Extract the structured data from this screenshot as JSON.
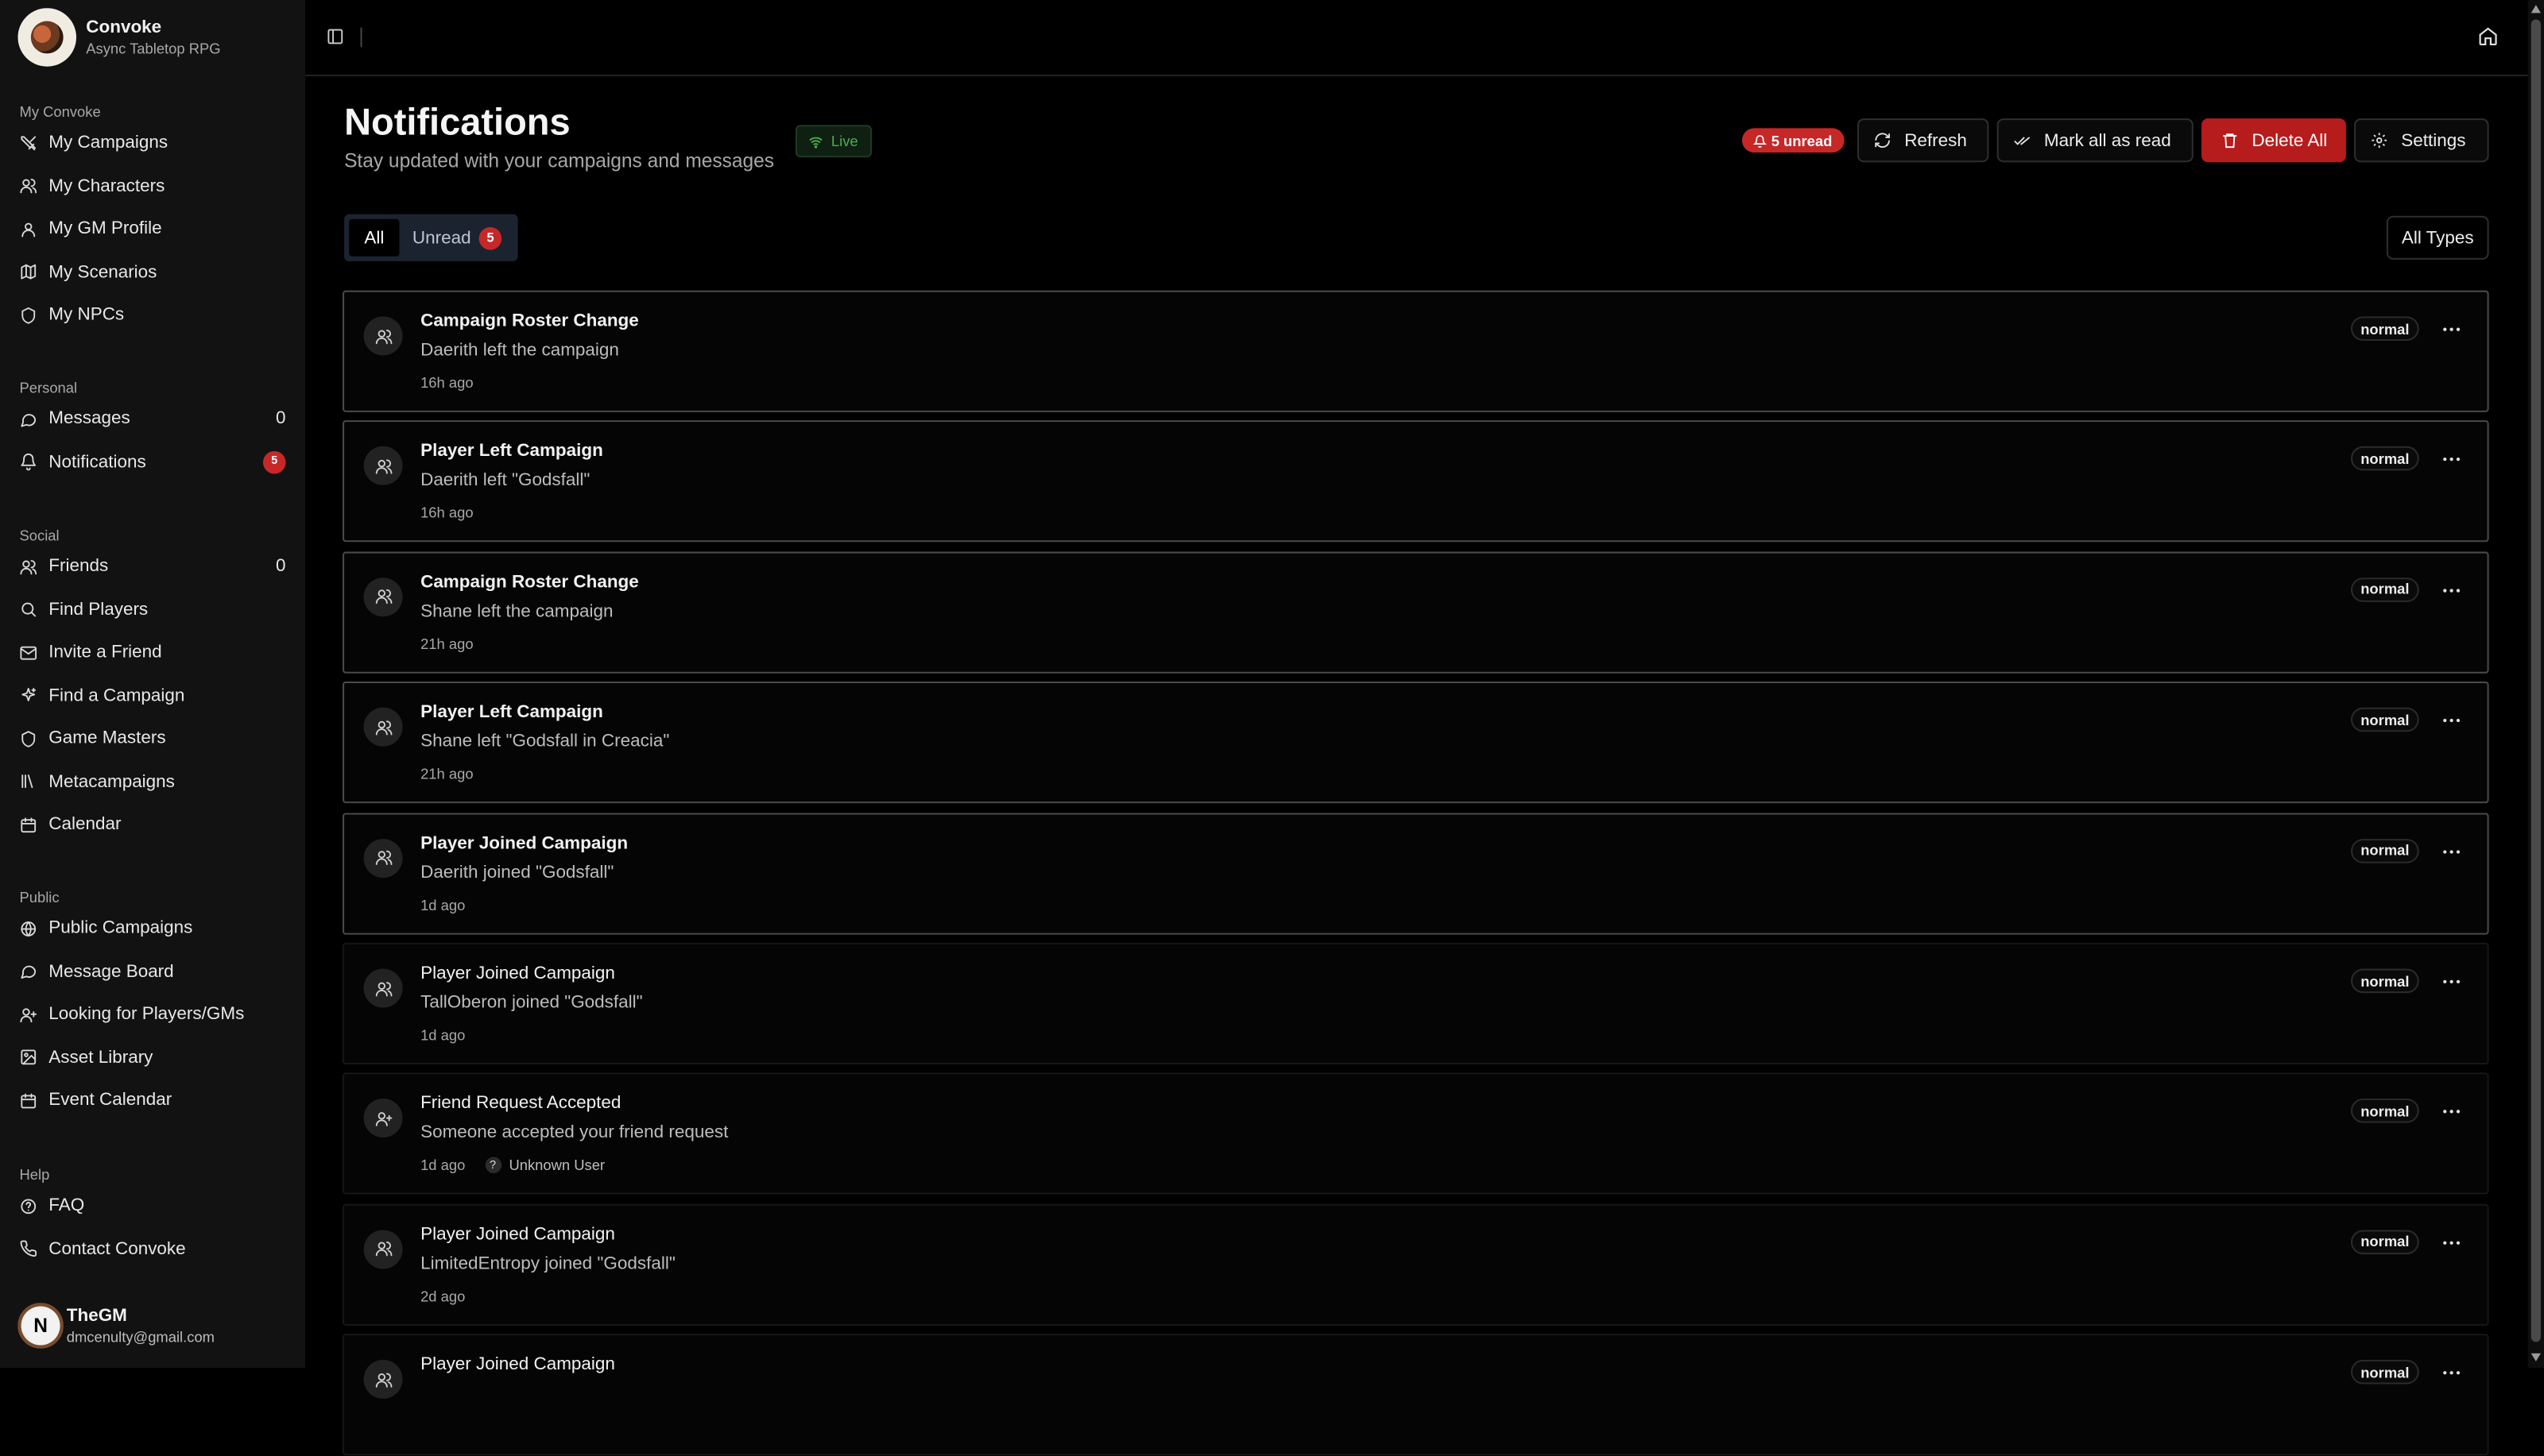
{
  "app": {
    "name": "Convoke",
    "tagline": "Async Tabletop RPG"
  },
  "sidebar": {
    "sections": [
      {
        "label": "My Convoke",
        "items": [
          {
            "label": "My Campaigns",
            "icon": "swords-icon"
          },
          {
            "label": "My Characters",
            "icon": "users-icon"
          },
          {
            "label": "My GM Profile",
            "icon": "user-icon"
          },
          {
            "label": "My Scenarios",
            "icon": "map-icon"
          },
          {
            "label": "My NPCs",
            "icon": "shield-icon"
          }
        ]
      },
      {
        "label": "Personal",
        "items": [
          {
            "label": "Messages",
            "icon": "message-icon",
            "count": "0"
          },
          {
            "label": "Notifications",
            "icon": "bell-icon",
            "badge": "5"
          }
        ]
      },
      {
        "label": "Social",
        "items": [
          {
            "label": "Friends",
            "icon": "users-icon",
            "count": "0"
          },
          {
            "label": "Find Players",
            "icon": "search-icon"
          },
          {
            "label": "Invite a Friend",
            "icon": "mail-icon"
          },
          {
            "label": "Find a Campaign",
            "icon": "sparkle-icon"
          },
          {
            "label": "Game Masters",
            "icon": "shield-icon"
          },
          {
            "label": "Metacampaigns",
            "icon": "library-icon"
          },
          {
            "label": "Calendar",
            "icon": "calendar-icon"
          }
        ]
      },
      {
        "label": "Public",
        "items": [
          {
            "label": "Public Campaigns",
            "icon": "globe-icon"
          },
          {
            "label": "Message Board",
            "icon": "message-icon"
          },
          {
            "label": "Looking for Players/GMs",
            "icon": "user-plus-icon"
          },
          {
            "label": "Asset Library",
            "icon": "image-icon"
          },
          {
            "label": "Event Calendar",
            "icon": "calendar-icon"
          }
        ]
      },
      {
        "label": "Help",
        "items": [
          {
            "label": "FAQ",
            "icon": "help-circle-icon"
          },
          {
            "label": "Contact Convoke",
            "icon": "phone-icon"
          }
        ]
      }
    ]
  },
  "user": {
    "initial": "N",
    "name": "TheGM",
    "email": "dmcenulty@gmail.com"
  },
  "header": {
    "title": "Notifications",
    "subtitle": "Stay updated with your campaigns and messages",
    "live_label": "Live",
    "unread_label": "5 unread",
    "buttons": {
      "refresh": "Refresh",
      "mark_all": "Mark all as read",
      "delete_all": "Delete All",
      "settings": "Settings"
    }
  },
  "tabs": {
    "all": "All",
    "unread": "Unread",
    "unread_count": "5"
  },
  "filter": {
    "types": "All Types"
  },
  "notifications": [
    {
      "title": "Campaign Roster Change",
      "message": "Daerith left the campaign",
      "time": "16h ago",
      "priority": "normal",
      "unread": true,
      "icon": "users-icon"
    },
    {
      "title": "Player Left Campaign",
      "message": "Daerith left \"Godsfall\"",
      "time": "16h ago",
      "priority": "normal",
      "unread": true,
      "icon": "users-icon"
    },
    {
      "title": "Campaign Roster Change",
      "message": "Shane left the campaign",
      "time": "21h ago",
      "priority": "normal",
      "unread": true,
      "icon": "users-icon"
    },
    {
      "title": "Player Left Campaign",
      "message": "Shane left \"Godsfall in Creacia\"",
      "time": "21h ago",
      "priority": "normal",
      "unread": true,
      "icon": "users-icon"
    },
    {
      "title": "Player Joined Campaign",
      "message": "Daerith joined \"Godsfall\"",
      "time": "1d ago",
      "priority": "normal",
      "unread": true,
      "icon": "users-icon"
    },
    {
      "title": "Player Joined Campaign",
      "message": "TallOberon joined \"Godsfall\"",
      "time": "1d ago",
      "priority": "normal",
      "unread": false,
      "icon": "users-icon"
    },
    {
      "title": "Friend Request Accepted",
      "message": "Someone accepted your friend request",
      "time": "1d ago",
      "priority": "normal",
      "unread": false,
      "icon": "user-plus-icon",
      "actor": "Unknown User"
    },
    {
      "title": "Player Joined Campaign",
      "message": "LimitedEntropy joined \"Godsfall\"",
      "time": "2d ago",
      "priority": "normal",
      "unread": false,
      "icon": "users-icon"
    },
    {
      "title": "Player Joined Campaign",
      "message": "",
      "time": "",
      "priority": "normal",
      "unread": false,
      "icon": "users-icon"
    }
  ],
  "colors": {
    "background": "#000000",
    "sidebar": "#121212",
    "danger": "#b71c1c",
    "badge": "#c62828",
    "live": "#4caf50"
  }
}
